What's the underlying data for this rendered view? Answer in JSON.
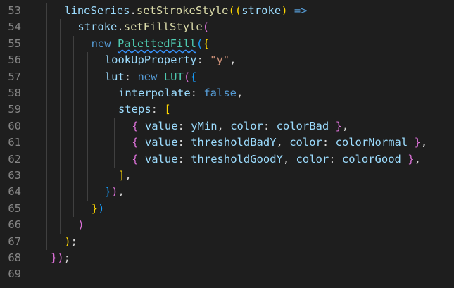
{
  "colors": {
    "background": "#1e1e1e",
    "line_number": "#858585",
    "indent_guide": "#404040",
    "identifier": "#9cdcfe",
    "method": "#dcdcaa",
    "keyword": "#569cd6",
    "class_name": "#4ec9b0",
    "string": "#ce9178",
    "bracket_gold": "#ffd700",
    "bracket_purple": "#da70d6",
    "bracket_blue": "#179fff",
    "punctuation": "#d4d4d4",
    "squiggle": "#3794ff"
  },
  "editor": {
    "lines": [
      {
        "number": "53",
        "indent": 1,
        "tokens": [
          {
            "text": "lineSeries",
            "color": "#9cdcfe"
          },
          {
            "text": ".",
            "color": "#d4d4d4"
          },
          {
            "text": "setStrokeStyle",
            "color": "#dcdcaa"
          },
          {
            "text": "((",
            "color": "#ffd700"
          },
          {
            "text": "stroke",
            "color": "#9cdcfe"
          },
          {
            "text": ")",
            "color": "#ffd700"
          },
          {
            "text": " ",
            "color": "#d4d4d4"
          },
          {
            "text": "=>",
            "color": "#569cd6"
          }
        ]
      },
      {
        "number": "54",
        "indent": 2,
        "tokens": [
          {
            "text": "stroke",
            "color": "#9cdcfe"
          },
          {
            "text": ".",
            "color": "#d4d4d4"
          },
          {
            "text": "setFillStyle",
            "color": "#dcdcaa"
          },
          {
            "text": "(",
            "color": "#da70d6"
          }
        ]
      },
      {
        "number": "55",
        "indent": 3,
        "tokens": [
          {
            "text": "new",
            "color": "#569cd6"
          },
          {
            "text": " ",
            "color": "#d4d4d4"
          },
          {
            "text": "PalettedFill",
            "color": "#4ec9b0",
            "squiggle": true
          },
          {
            "text": "(",
            "color": "#179fff"
          },
          {
            "text": "{",
            "color": "#ffd700"
          }
        ]
      },
      {
        "number": "56",
        "indent": 4,
        "tokens": [
          {
            "text": "lookUpProperty",
            "color": "#9cdcfe"
          },
          {
            "text": ": ",
            "color": "#d4d4d4"
          },
          {
            "text": "\"y\"",
            "color": "#ce9178"
          },
          {
            "text": ",",
            "color": "#d4d4d4"
          }
        ]
      },
      {
        "number": "57",
        "indent": 4,
        "tokens": [
          {
            "text": "lut",
            "color": "#9cdcfe"
          },
          {
            "text": ": ",
            "color": "#d4d4d4"
          },
          {
            "text": "new",
            "color": "#569cd6"
          },
          {
            "text": " ",
            "color": "#d4d4d4"
          },
          {
            "text": "LUT",
            "color": "#4ec9b0"
          },
          {
            "text": "(",
            "color": "#da70d6"
          },
          {
            "text": "{",
            "color": "#179fff"
          }
        ]
      },
      {
        "number": "58",
        "indent": 5,
        "tokens": [
          {
            "text": "interpolate",
            "color": "#9cdcfe"
          },
          {
            "text": ": ",
            "color": "#d4d4d4"
          },
          {
            "text": "false",
            "color": "#569cd6"
          },
          {
            "text": ",",
            "color": "#d4d4d4"
          }
        ]
      },
      {
        "number": "59",
        "indent": 5,
        "tokens": [
          {
            "text": "steps",
            "color": "#9cdcfe"
          },
          {
            "text": ": ",
            "color": "#d4d4d4"
          },
          {
            "text": "[",
            "color": "#ffd700"
          }
        ]
      },
      {
        "number": "60",
        "indent": 6,
        "tokens": [
          {
            "text": "{",
            "color": "#da70d6"
          },
          {
            "text": " ",
            "color": "#d4d4d4"
          },
          {
            "text": "value",
            "color": "#9cdcfe"
          },
          {
            "text": ": ",
            "color": "#d4d4d4"
          },
          {
            "text": "yMin",
            "color": "#9cdcfe"
          },
          {
            "text": ", ",
            "color": "#d4d4d4"
          },
          {
            "text": "color",
            "color": "#9cdcfe"
          },
          {
            "text": ": ",
            "color": "#d4d4d4"
          },
          {
            "text": "colorBad",
            "color": "#9cdcfe"
          },
          {
            "text": " ",
            "color": "#d4d4d4"
          },
          {
            "text": "}",
            "color": "#da70d6"
          },
          {
            "text": ",",
            "color": "#d4d4d4"
          }
        ]
      },
      {
        "number": "61",
        "indent": 6,
        "tokens": [
          {
            "text": "{",
            "color": "#da70d6"
          },
          {
            "text": " ",
            "color": "#d4d4d4"
          },
          {
            "text": "value",
            "color": "#9cdcfe"
          },
          {
            "text": ": ",
            "color": "#d4d4d4"
          },
          {
            "text": "thresholdBadY",
            "color": "#9cdcfe"
          },
          {
            "text": ", ",
            "color": "#d4d4d4"
          },
          {
            "text": "color",
            "color": "#9cdcfe"
          },
          {
            "text": ": ",
            "color": "#d4d4d4"
          },
          {
            "text": "colorNormal",
            "color": "#9cdcfe"
          },
          {
            "text": " ",
            "color": "#d4d4d4"
          },
          {
            "text": "}",
            "color": "#da70d6"
          },
          {
            "text": ",",
            "color": "#d4d4d4"
          }
        ]
      },
      {
        "number": "62",
        "indent": 6,
        "tokens": [
          {
            "text": "{",
            "color": "#da70d6"
          },
          {
            "text": " ",
            "color": "#d4d4d4"
          },
          {
            "text": "value",
            "color": "#9cdcfe"
          },
          {
            "text": ": ",
            "color": "#d4d4d4"
          },
          {
            "text": "thresholdGoodY",
            "color": "#9cdcfe"
          },
          {
            "text": ", ",
            "color": "#d4d4d4"
          },
          {
            "text": "color",
            "color": "#9cdcfe"
          },
          {
            "text": ": ",
            "color": "#d4d4d4"
          },
          {
            "text": "colorGood",
            "color": "#9cdcfe"
          },
          {
            "text": " ",
            "color": "#d4d4d4"
          },
          {
            "text": "}",
            "color": "#da70d6"
          },
          {
            "text": ",",
            "color": "#d4d4d4"
          }
        ]
      },
      {
        "number": "63",
        "indent": 5,
        "tokens": [
          {
            "text": "]",
            "color": "#ffd700"
          },
          {
            "text": ",",
            "color": "#d4d4d4"
          }
        ]
      },
      {
        "number": "64",
        "indent": 4,
        "tokens": [
          {
            "text": "}",
            "color": "#179fff"
          },
          {
            "text": ")",
            "color": "#da70d6"
          },
          {
            "text": ",",
            "color": "#d4d4d4"
          }
        ]
      },
      {
        "number": "65",
        "indent": 3,
        "tokens": [
          {
            "text": "}",
            "color": "#ffd700"
          },
          {
            "text": ")",
            "color": "#179fff"
          }
        ]
      },
      {
        "number": "66",
        "indent": 2,
        "tokens": [
          {
            "text": ")",
            "color": "#da70d6"
          }
        ]
      },
      {
        "number": "67",
        "indent": 1,
        "tokens": [
          {
            "text": ")",
            "color": "#ffd700"
          },
          {
            "text": ";",
            "color": "#d4d4d4"
          }
        ]
      },
      {
        "number": "68",
        "indent": 0,
        "tokens": [
          {
            "text": "})",
            "color": "#da70d6"
          },
          {
            "text": ";",
            "color": "#d4d4d4"
          }
        ]
      },
      {
        "number": "69",
        "indent": 0,
        "tokens": []
      }
    ]
  }
}
